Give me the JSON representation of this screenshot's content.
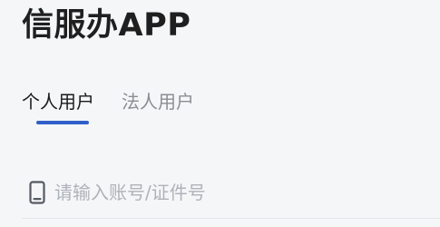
{
  "app": {
    "title": "信服办APP"
  },
  "tabs": [
    {
      "label": "个人用户",
      "active": true
    },
    {
      "label": "法人用户",
      "active": false
    }
  ],
  "login": {
    "account_placeholder": "请输入账号/证件号",
    "account_value": ""
  },
  "icons": {
    "account": "mobile-phone-icon"
  },
  "colors": {
    "accent": "#2f5fc9",
    "title_text": "#1f1f1f",
    "inactive_tab": "#8a8d93",
    "placeholder": "#aeb2ba",
    "background": "#f5f6f8"
  }
}
